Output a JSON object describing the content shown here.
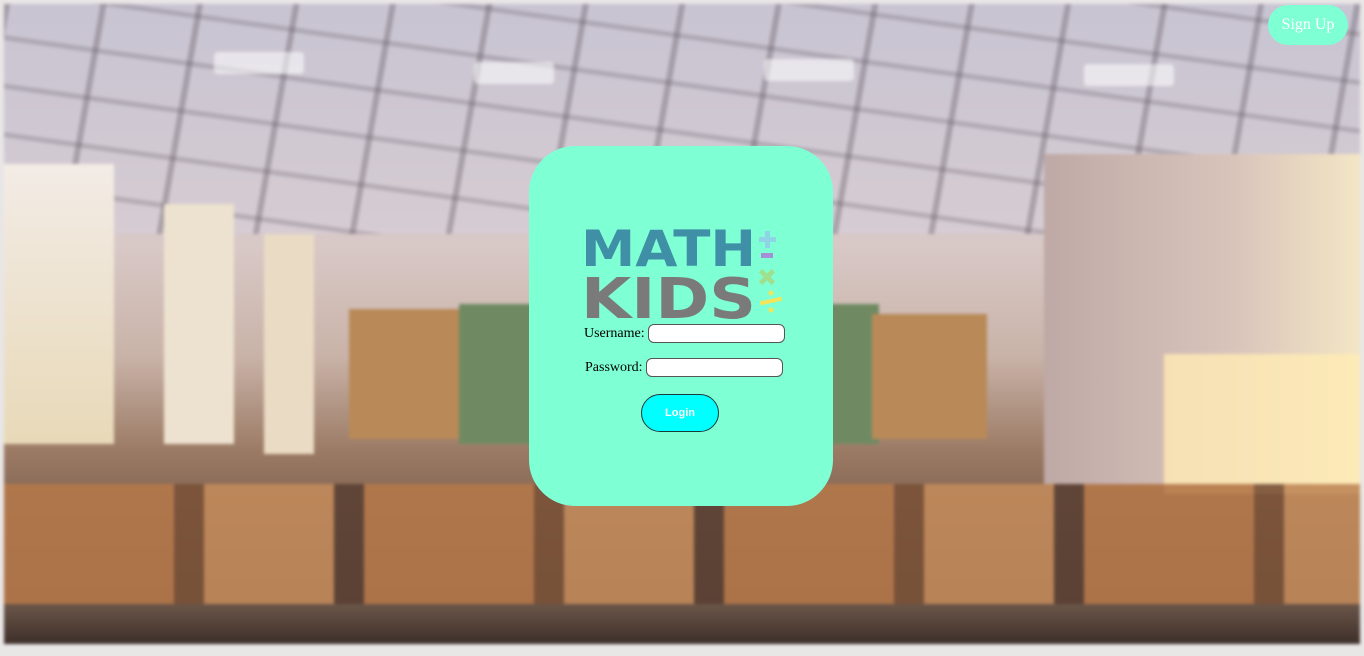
{
  "header": {
    "signup_label": "Sign Up"
  },
  "logo": {
    "line1": "MATH",
    "line2": "KIDS",
    "icon": "math-kids-logo-icon"
  },
  "form": {
    "username_label": "Username:",
    "username_value": "",
    "password_label": "Password:",
    "password_value": "",
    "login_label": "Login"
  },
  "colors": {
    "accent": "#7fffd4",
    "login_button": "#00ffff",
    "logo_teal": "#3f8fa6",
    "logo_gray": "#7a7a7a"
  }
}
